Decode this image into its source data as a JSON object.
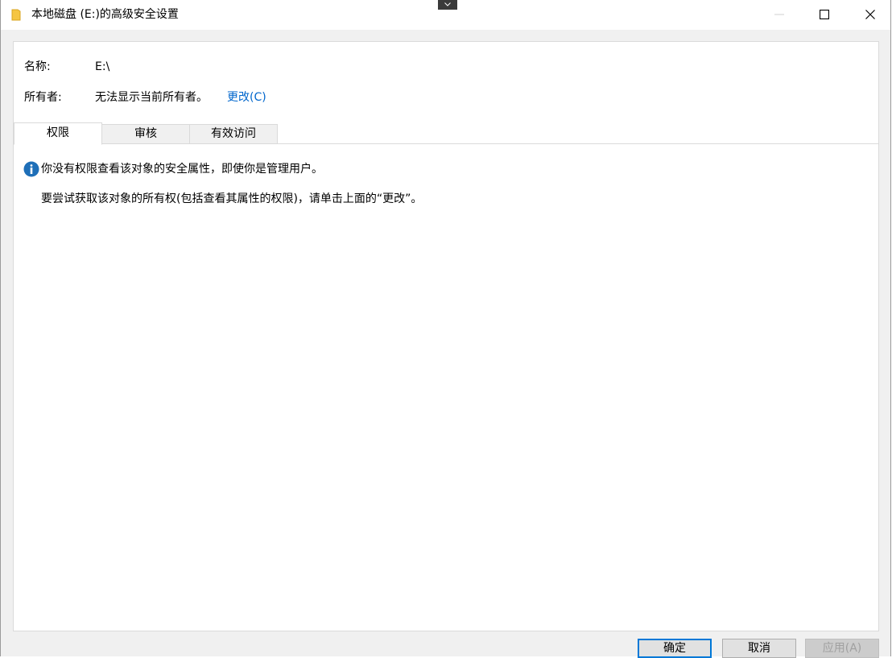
{
  "window": {
    "title": "本地磁盘 (E:)的高级安全设置",
    "icons": {
      "app": "folder-icon",
      "dropdown": "chevron-down-icon",
      "minimize": "minimize-icon",
      "maximize": "maximize-icon",
      "close": "close-icon"
    }
  },
  "info": {
    "name_label": "名称:",
    "name_value": "E:\\",
    "owner_label": "所有者:",
    "owner_value": "无法显示当前所有者。",
    "change_link": "更改(C)"
  },
  "tabs": [
    {
      "label": "权限",
      "active": true
    },
    {
      "label": "审核",
      "active": false
    },
    {
      "label": "有效访问",
      "active": false
    }
  ],
  "message": {
    "icon": "info-icon",
    "text": "你没有权限查看该对象的安全属性，即使你是管理用户。",
    "hint": "要尝试获取该对象的所有权(包括查看其属性的权限)，请单击上面的“更改”。"
  },
  "footer": {
    "ok": "确定",
    "cancel": "取消",
    "apply": "应用(A)",
    "apply_enabled": false
  },
  "colors": {
    "link": "#0066cc",
    "info_icon": "#1e6fb8",
    "ok_border": "#0078d7",
    "folder": "#f5c542"
  }
}
